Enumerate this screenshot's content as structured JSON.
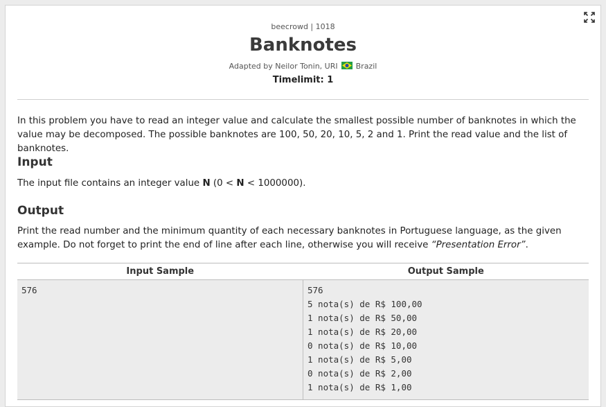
{
  "problem": {
    "meta": "beecrowd | 1018",
    "title": "Banknotes",
    "adapted_prefix": "Adapted by Neilor Tonin, URI",
    "adapted_country": "Brazil",
    "timelimit": "Timelimit: 1"
  },
  "description": "In this problem you have to read an integer value and calculate the smallest possible number of banknotes in which the value may be decomposed. The possible banknotes are 100, 50, 20, 10, 5, 2 and 1. Print the read value and the list of banknotes.",
  "input": {
    "heading": "Input",
    "text_before": "The input file contains an integer value ",
    "var1": "N",
    "text_mid": " (0 < ",
    "var2": "N",
    "text_after": " < 1000000)."
  },
  "output": {
    "heading": "Output",
    "text_before": "Print the read number and the minimum quantity of each necessary banknotes in Portuguese language, as the given example. Do not forget to print the end of line after each line, otherwise you will receive ",
    "emphasis": "“Presentation Error”",
    "text_after": "."
  },
  "samples": {
    "input_header": "Input Sample",
    "output_header": "Output Sample",
    "input_text": "576",
    "output_text": "576\n5 nota(s) de R$ 100,00\n1 nota(s) de R$ 50,00\n1 nota(s) de R$ 20,00\n0 nota(s) de R$ 10,00\n1 nota(s) de R$ 5,00\n0 nota(s) de R$ 2,00\n1 nota(s) de R$ 1,00"
  },
  "icons": {
    "fullscreen": "expand-icon",
    "flag": "brazil-flag-icon"
  },
  "colors": {
    "sample_bg": "#ececec",
    "flag_green": "#229e45",
    "flag_yellow": "#f8e509",
    "flag_blue": "#2b49a3"
  }
}
